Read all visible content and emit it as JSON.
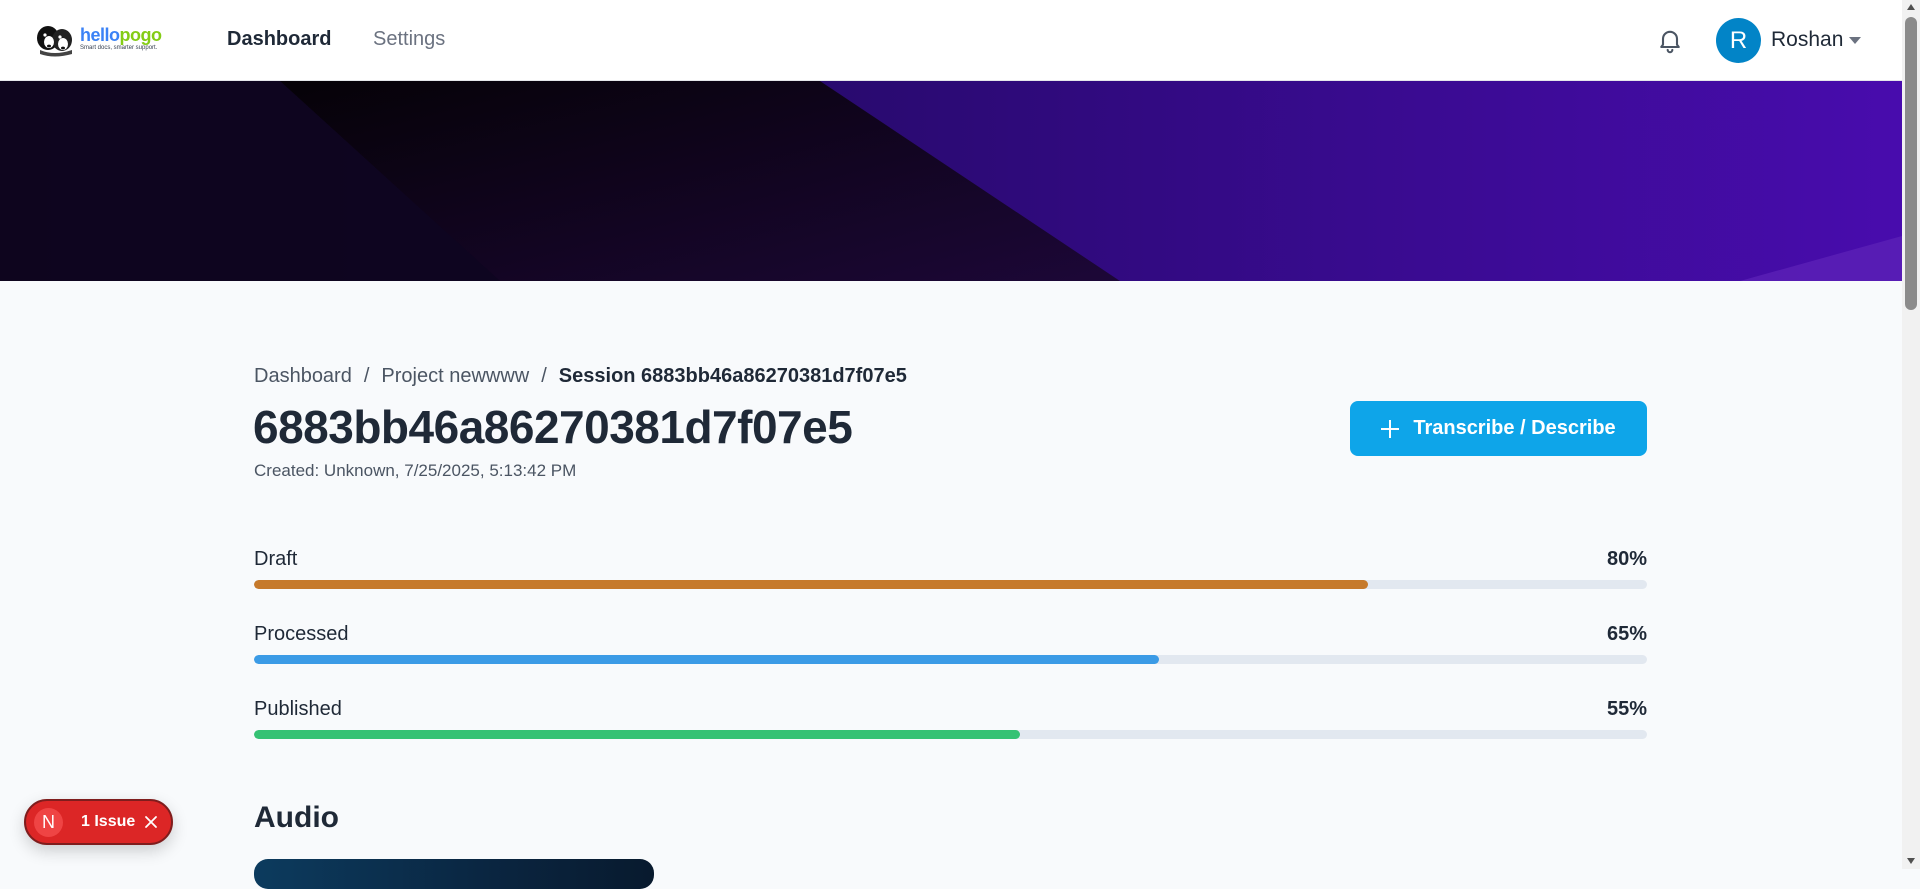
{
  "header": {
    "logo": {
      "brand_hello": "hello",
      "brand_pogo": "pogo",
      "tagline": "Smart docs, smarter support."
    },
    "nav": [
      {
        "label": "Dashboard"
      },
      {
        "label": "Settings"
      }
    ],
    "notifications_icon": "bell-icon",
    "user": {
      "initial": "R",
      "name": "Roshan"
    }
  },
  "breadcrumb": {
    "items": [
      "Dashboard",
      "Project newwww",
      "Session 6883bb46a86270381d7f07e5"
    ],
    "separator": "/"
  },
  "session": {
    "title": "6883bb46a86270381d7f07e5",
    "created": "Created: Unknown, 7/25/2025, 5:13:42 PM"
  },
  "actions": {
    "transcribe_label": "Transcribe / Describe"
  },
  "progress": [
    {
      "label": "Draft",
      "percent_label": "80%",
      "value": 80,
      "color": "#c67a2c"
    },
    {
      "label": "Processed",
      "percent_label": "65%",
      "value": 65,
      "color": "#3b9be6"
    },
    {
      "label": "Published",
      "percent_label": "55%",
      "value": 55,
      "color": "#35c274"
    }
  ],
  "sections": {
    "audio_title": "Audio"
  },
  "issue_badge": {
    "initial": "N",
    "text": "1 Issue"
  },
  "colors": {
    "primary": "#0ea5e9",
    "avatar": "#0284c7",
    "issue": "#dc2626",
    "banner_dark": "#0b0512",
    "banner_purple": "#3a0a8f"
  }
}
